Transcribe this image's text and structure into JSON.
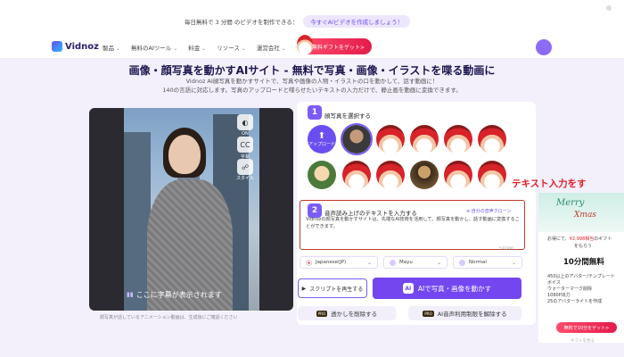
{
  "announcement": {
    "text": "毎日無料で 3 分間 のビデオを制作できる：",
    "link": "今すぐAIビデオを作成しましょう！"
  },
  "nav": {
    "logo": "Vidnoz",
    "items": [
      "製品",
      "無料のAIツール",
      "料金",
      "リソース",
      "運営会社"
    ],
    "gift_button": "無料ギフトをゲット>"
  },
  "hero": {
    "title": "画像・顔写真を動かすAIサイト - 無料で写真・画像・イラストを喋る動画に",
    "sub_line1": "Vidnoz AI顔写真を動かすサイトで、写真や画像の人物・イラストの口を動かして、話す動画に！",
    "sub_line2": "140の言語に対応します。写真のアップロードと喋らせたいテキストの入力だけで、静止画を動画に変換できます。"
  },
  "preview": {
    "tools": [
      "ON",
      "字幕",
      "スタイル"
    ],
    "subtitle_text": "ここに字幕が表示されます",
    "note": "顔写真が話しているアニメーション動画は、生成後にご確認ください"
  },
  "step1": {
    "num": "1",
    "label": "顔写真を選択する",
    "upload_label": "アップロード"
  },
  "step2": {
    "num": "2",
    "label": "音声読み上げのテキストを入力する",
    "sample_link": "≡ 自分の音声クローン",
    "text": "Vidnozの顔写真を動かすサイトは、先端なAI技術を活用して、顔写真を動かし、話す動画に変換することができます。",
    "char_count": "57/300"
  },
  "selects": {
    "language": "Japanese(JP)",
    "voice": "Mayu",
    "style": "Normal"
  },
  "buttons": {
    "replay": "スクリプトを再生する",
    "generate": "AIで写真・画像を動かす",
    "ai_badge": "AI",
    "remove_watermark": "透かしを削除する",
    "voice_limit": "AI音声利用制限を解除する",
    "pro": "PRO"
  },
  "annotation": "テキスト入力をす",
  "promo": {
    "merry": "Merry",
    "xmas": "Xmas",
    "line1_prefix": "お得にて、",
    "line1_price": "¥2,998相当",
    "line1_suffix": "のギフト",
    "line2": "をもらう",
    "big": "10分間無料",
    "items": [
      "450以上のアバター/テンプレート",
      "ボイス",
      "ウォーターマーク削除",
      "1080P出力",
      "25のアバターライトを作成"
    ],
    "button": "無料で10分をゲット>",
    "fine": "ギフトを見る"
  }
}
